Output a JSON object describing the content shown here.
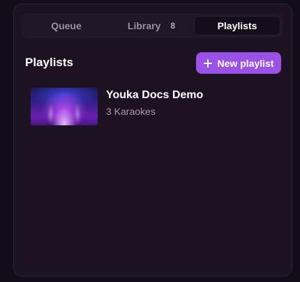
{
  "tabs": [
    {
      "label": "Queue",
      "count": ""
    },
    {
      "label": "Library",
      "count": "8"
    },
    {
      "label": "Playlists",
      "count": ""
    }
  ],
  "active_tab": "Playlists",
  "section": {
    "title": "Playlists",
    "new_button_label": "New playlist",
    "new_button_icon": "plus-icon"
  },
  "playlists": [
    {
      "name": "Youka Docs Demo",
      "count_label": "3 Karaokes"
    }
  ],
  "colors": {
    "accent": "#9b51e6",
    "panel_bg": "#1c1222",
    "page_bg": "#120d17"
  }
}
